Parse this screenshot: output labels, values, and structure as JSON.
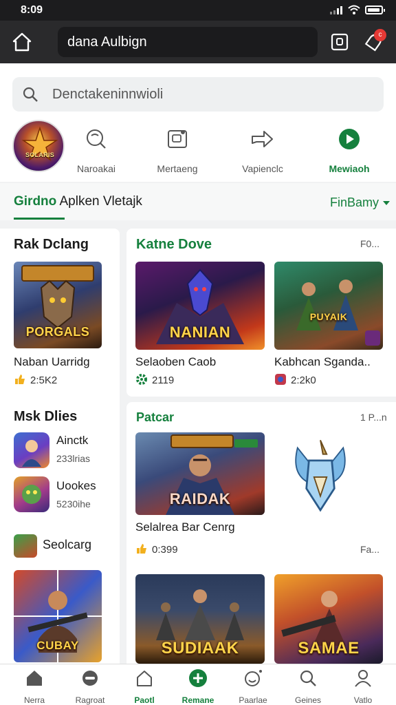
{
  "status": {
    "time": "8:09"
  },
  "topbar": {
    "url": "dana Aulbign",
    "badge": "c"
  },
  "search": {
    "placeholder": "Denctakeninnwioli"
  },
  "categories": [
    {
      "label": "Naroakai",
      "icon": "gamepad-icon"
    },
    {
      "label": "Mertaeng",
      "icon": "gallery-icon"
    },
    {
      "label": "Vapienclc",
      "icon": "share-icon"
    },
    {
      "label": "Mewiaoh",
      "icon": "play-icon"
    }
  ],
  "avatar": {
    "label": "SOLARIS"
  },
  "section": {
    "title_prefix": "Girdno",
    "title_rest": " Aplken Vletajk",
    "more": "FinBamy"
  },
  "left": {
    "heading1": "Rak Dclang",
    "game1": {
      "title": "Naban Uarridg",
      "stat": "2:5K2",
      "banner": "PORGALS"
    },
    "heading2": "Msk Dlies",
    "list": [
      {
        "title": "Ainctk",
        "stat": "233lrias"
      },
      {
        "title": "Uookes",
        "stat": "5230ihe"
      }
    ],
    "heading3": "Seolcarg",
    "banner3": "CUBAY"
  },
  "card1": {
    "heading": "Katne Dove",
    "meta": "F0...",
    "games": [
      {
        "title": "Selaoben Caob",
        "stat": "2119",
        "banner": "NANIAN"
      },
      {
        "title": "Kabhcan Sganda..",
        "stat": "2:2k0",
        "banner": "PUYAIK"
      }
    ]
  },
  "card2": {
    "heading": "Patcar",
    "meta": "1 P...n",
    "game": {
      "title": "Selalrea Bar Cenrg",
      "stat": "0:399",
      "banner": "RAIDAK"
    },
    "meta2": "Fa...",
    "banners": [
      "SUDIAAK",
      "SAMAE"
    ]
  },
  "nav": [
    {
      "label": "Nerra",
      "icon": "home-icon"
    },
    {
      "label": "Ragroat",
      "icon": "controller-icon"
    },
    {
      "label": "Paotl",
      "icon": "house-icon"
    },
    {
      "label": "Remane",
      "icon": "plus-icon"
    },
    {
      "label": "Paarlae",
      "icon": "smile-icon"
    },
    {
      "label": "Geines",
      "icon": "search-icon"
    },
    {
      "label": "Vatlo",
      "icon": "profile-icon"
    }
  ],
  "colors": {
    "accent": "#15803d",
    "topbar": "#2a2a2c",
    "badge": "#e53935"
  }
}
